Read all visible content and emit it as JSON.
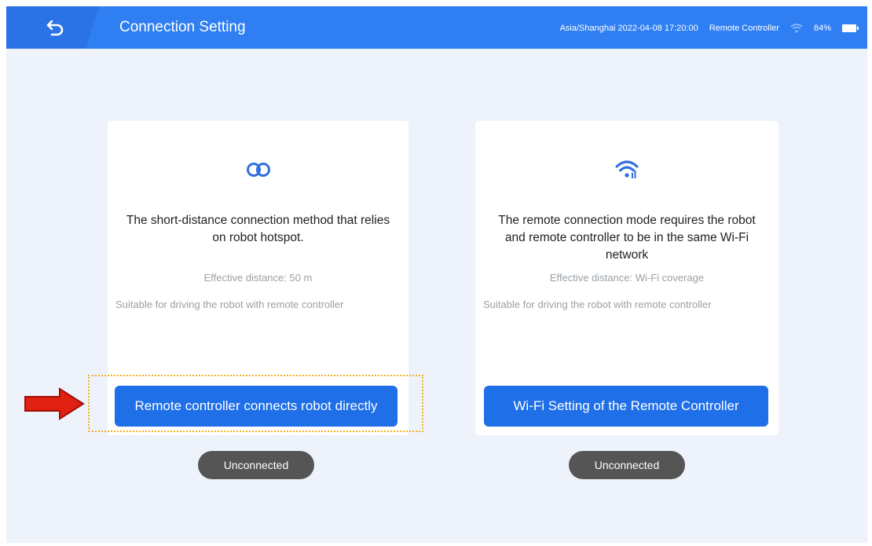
{
  "header": {
    "back_icon": "back-arrow-icon",
    "title": "Connection Setting",
    "status": {
      "timezone_time": "Asia/Shanghai 2022-04-08 17:20:00",
      "mode": "Remote Controller",
      "battery": "84%"
    }
  },
  "cards": [
    {
      "icon": "link-icon",
      "description": "The short-distance connection method that relies on robot hotspot.",
      "distance": "Effective distance: 50 m",
      "suitable": "Suitable for driving the robot with remote controller",
      "button_label": "Remote controller connects robot directly",
      "status": "Unconnected"
    },
    {
      "icon": "wifi-icon",
      "description": "The remote connection mode requires the robot and remote controller to be in the same Wi-Fi network",
      "distance": "Effective distance: Wi-Fi coverage",
      "suitable": "Suitable for driving the robot with remote controller",
      "button_label": "Wi-Fi Setting of the Remote Controller",
      "status": "Unconnected"
    }
  ],
  "colors": {
    "header": "#2f7ff2",
    "button": "#1f6fe8",
    "highlight": "#f2b01e",
    "arrow": "#e02010",
    "pill": "#555555"
  }
}
